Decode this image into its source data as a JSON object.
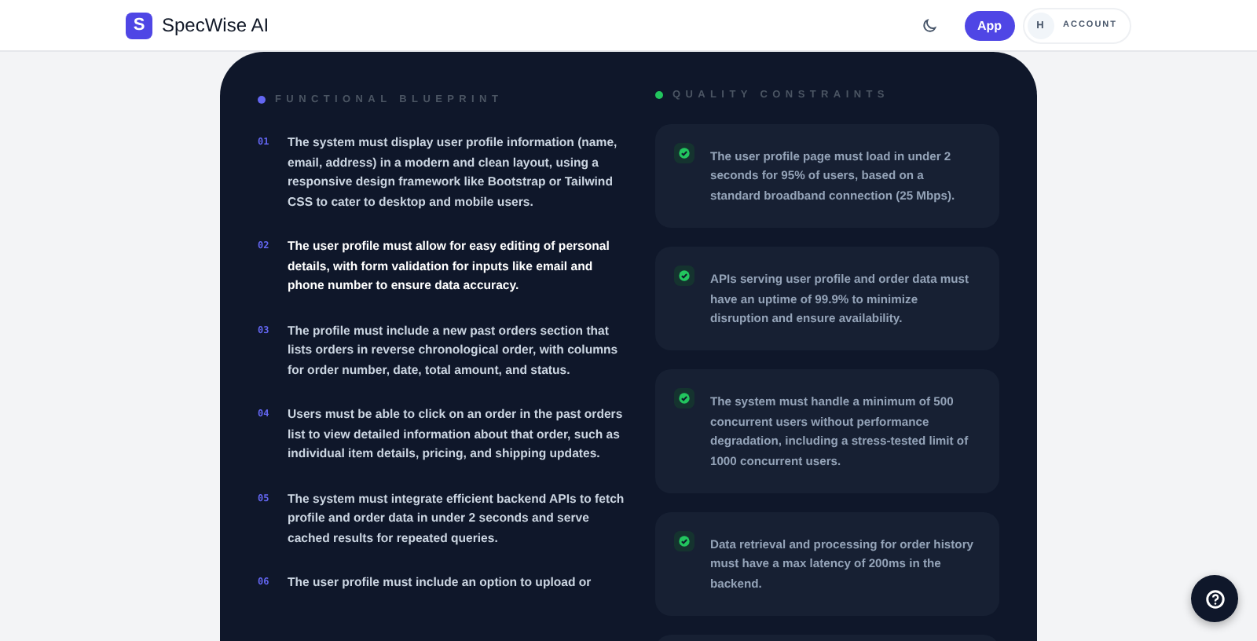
{
  "header": {
    "logo_letter": "S",
    "brand": "SpecWise AI",
    "app_button": "App",
    "account": {
      "initial": "H",
      "label": "ACCOUNT"
    }
  },
  "functional": {
    "title": "FUNCTIONAL BLUEPRINT",
    "items": [
      {
        "number": "01",
        "text": "The system must display user profile information (name, email, address) in a modern and clean layout, using a responsive design framework like Bootstrap or Tailwind CSS to cater to desktop and mobile users.",
        "selected": false
      },
      {
        "number": "02",
        "text": "The user profile must allow for easy editing of personal details, with form validation for inputs like email and phone number to ensure data accuracy.",
        "selected": true
      },
      {
        "number": "03",
        "text": "The profile must include a new past orders section that lists orders in reverse chronological order, with columns for order number, date, total amount, and status.",
        "selected": false
      },
      {
        "number": "04",
        "text": "Users must be able to click on an order in the past orders list to view detailed information about that order, such as individual item details, pricing, and shipping updates.",
        "selected": false
      },
      {
        "number": "05",
        "text": "The system must integrate efficient backend APIs to fetch profile and order data in under 2 seconds and serve cached results for repeated queries.",
        "selected": false
      },
      {
        "number": "06",
        "text": "The user profile must include an option to upload or",
        "selected": false
      }
    ]
  },
  "quality": {
    "title": "QUALITY CONSTRAINTS",
    "items": [
      {
        "text": "The user profile page must load in under 2 seconds for 95% of users, based on a standard broadband connection (25 Mbps)."
      },
      {
        "text": "APIs serving user profile and order data must have an uptime of 99.9% to minimize disruption and ensure availability."
      },
      {
        "text": "The system must handle a minimum of 500 concurrent users without performance degradation, including a stress-tested limit of 1000 concurrent users."
      },
      {
        "text": "Data retrieval and processing for order history must have a max latency of 200ms in the backend."
      }
    ]
  }
}
